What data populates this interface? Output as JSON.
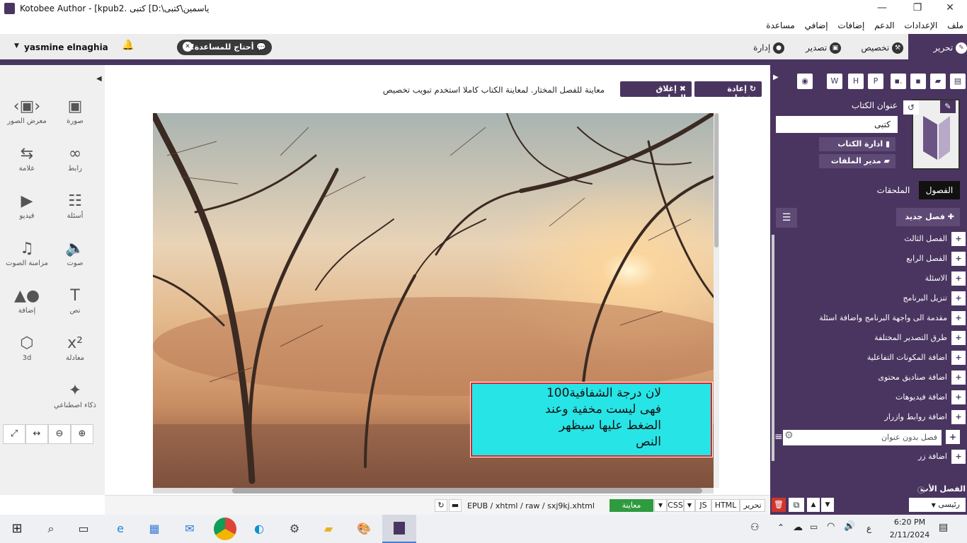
{
  "window": {
    "title": "Kotobee Author - [kpub2. كتبى [D:\\ياسمين\\كتبى",
    "minimize": "—",
    "maximize": "❐",
    "close": "✕"
  },
  "menu": [
    "ملف",
    "الإعدادات",
    "الدعم",
    "إضافات",
    "إضافي",
    "مساعدة"
  ],
  "topbar": {
    "user": "yasmine elnaghia",
    "help_label": "أحتاج للمساعدة!",
    "tabs": [
      {
        "label": "تحرير",
        "icon": "pencil-icon"
      },
      {
        "label": "تخصيص",
        "icon": "wrench-icon"
      },
      {
        "label": "تصدير",
        "icon": "export-icon"
      },
      {
        "label": "إدارة",
        "icon": "user-icon"
      }
    ]
  },
  "tools": [
    {
      "label": "صورة",
      "icon": "image-icon",
      "glyph": "▣"
    },
    {
      "label": "معرض الصور",
      "icon": "gallery-icon",
      "glyph": "‹▣›"
    },
    {
      "label": "رابط",
      "icon": "link-icon",
      "glyph": "∞"
    },
    {
      "label": "علامة",
      "icon": "bookmark-icon",
      "glyph": "⇆"
    },
    {
      "label": "أسئلة",
      "icon": "questions-icon",
      "glyph": "☷"
    },
    {
      "label": "فيديو",
      "icon": "video-icon",
      "glyph": "▶"
    },
    {
      "label": "صوت",
      "icon": "audio-icon",
      "glyph": "🔈"
    },
    {
      "label": "مزامنة الصوت",
      "icon": "audio-sync-icon",
      "glyph": "♫"
    },
    {
      "label": "نص",
      "icon": "text-icon",
      "glyph": "T"
    },
    {
      "label": "إضافة",
      "icon": "widget-icon",
      "glyph": "▲●"
    },
    {
      "label": "معادلة",
      "icon": "equation-icon",
      "glyph": "x²"
    },
    {
      "label": "3d",
      "icon": "cube-icon",
      "glyph": "⬡"
    },
    {
      "label": "ذكاء اصطناعي",
      "icon": "magic-wand-icon",
      "glyph": "✦"
    }
  ],
  "zoom": [
    {
      "icon": "fullscreen-icon",
      "glyph": "⤢"
    },
    {
      "icon": "fit-width-icon",
      "glyph": "↔"
    },
    {
      "icon": "zoom-out-icon",
      "glyph": "⊖"
    },
    {
      "icon": "zoom-in-icon",
      "glyph": "⊕"
    }
  ],
  "preview": {
    "rerun": "إعادة تشغيل",
    "close": "إغلاق المعاينة",
    "message": "معاينة للفصل المختار. لمعاينة الكتاب كاملا استخدم تبويب تخصيص",
    "callout_lines": [
      "لان درجة الشفافية100",
      "فهى ليست مخفية وعند",
      "الضغط عليها سيظهر",
      "النص"
    ]
  },
  "bottom": {
    "edit": "تحرير",
    "html": "HTML",
    "js": "JS",
    "css": "CSS",
    "preview": "معاينة",
    "path": "EPUB / xhtml / raw / sxj9kj.xhtml"
  },
  "book": {
    "title_label": "عنوان الكتاب",
    "title_value": "كتبى",
    "manage": "ادارة الكتاب",
    "files": "مدير الملفات",
    "tab_chapters": "الفصول",
    "tab_attachments": "الملحقات",
    "new_chapter": "فصل جديد"
  },
  "chapters": [
    "الفصل الثالث",
    "الفصل الرابع",
    "الاسئلة",
    "تنزيل البرنامج",
    "مقدمة الى واجهة البرنامج واضافة اسئلة",
    "طرق التصدير المختلفة",
    "اضافة المكونات التفاعلية",
    "اضافة صناديق محتوى",
    "اضافة فيديوهات",
    "اضافة روابط وازرار"
  ],
  "chapter_input": "فصل بدون عنوان",
  "chapter_last": "اضافة زر",
  "parent": {
    "label": "الفصل الأب",
    "value": "رئيسى"
  },
  "clock": {
    "time": "6:20 PM",
    "date": "2/11/2024",
    "lang": "ع"
  },
  "colors": {
    "brand": "#4a3560",
    "callout": "#27e4e6",
    "preview_btn": "#2e9b3e"
  }
}
